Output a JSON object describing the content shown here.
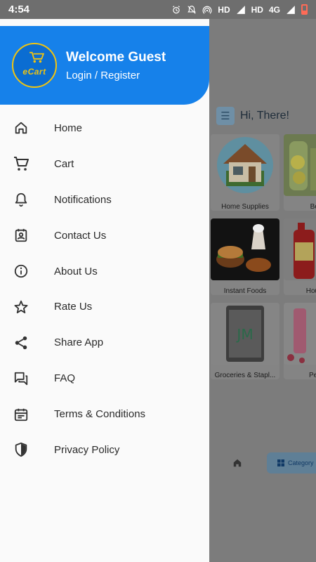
{
  "status_bar": {
    "time": "4:54",
    "network_1": "HD",
    "network_2": "HD",
    "network_type": "4G"
  },
  "drawer": {
    "logo_text": "eCart",
    "welcome": "Welcome Guest",
    "login_register": "Login / Register",
    "items": [
      {
        "label": "Home",
        "icon": "home-icon"
      },
      {
        "label": "Cart",
        "icon": "cart-icon"
      },
      {
        "label": "Notifications",
        "icon": "bell-icon"
      },
      {
        "label": "Contact Us",
        "icon": "contact-icon"
      },
      {
        "label": "About Us",
        "icon": "info-icon"
      },
      {
        "label": "Rate Us",
        "icon": "star-icon"
      },
      {
        "label": "Share App",
        "icon": "share-icon"
      },
      {
        "label": "FAQ",
        "icon": "faq-icon"
      },
      {
        "label": "Terms & Conditions",
        "icon": "calendar-icon"
      },
      {
        "label": "Privacy Policy",
        "icon": "shield-icon"
      }
    ]
  },
  "background": {
    "greeting": "Hi, There!",
    "categories": [
      {
        "label": "Home Supplies"
      },
      {
        "label": "Beve"
      },
      {
        "label": "Instant Foods"
      },
      {
        "label": "Househ"
      },
      {
        "label": "Groceries & Stapl..."
      },
      {
        "label": "Perso"
      }
    ],
    "bottom_nav": {
      "category_label": "Category"
    }
  },
  "colors": {
    "accent": "#1681ea",
    "logo_gold": "#f1c40f"
  }
}
